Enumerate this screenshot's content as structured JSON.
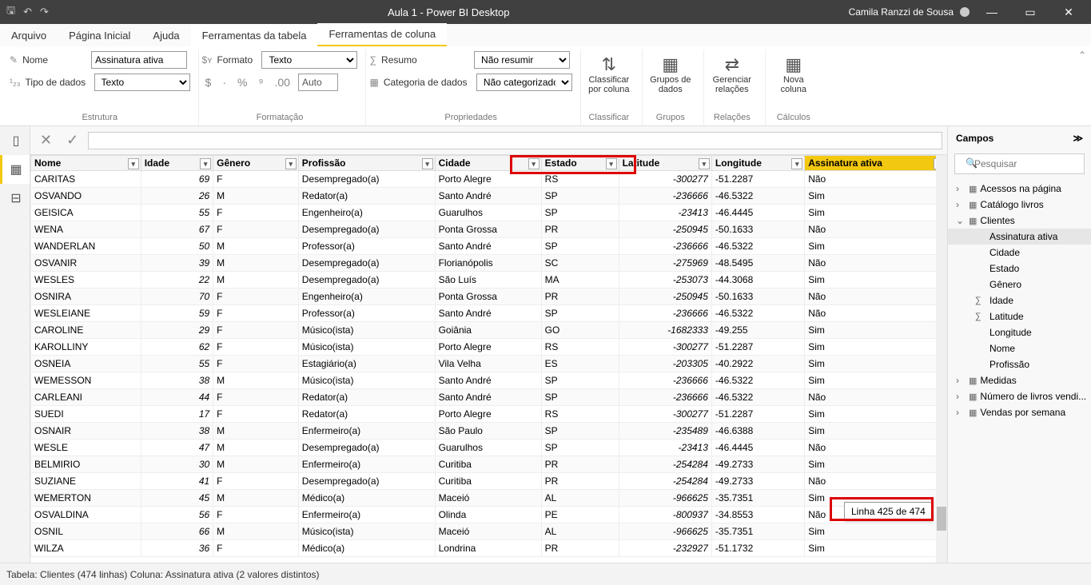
{
  "titlebar": {
    "title": "Aula 1 - Power BI Desktop",
    "user": "Camila Ranzzi de Sousa"
  },
  "menu": {
    "arquivo": "Arquivo",
    "pagina": "Página Inicial",
    "ajuda": "Ajuda",
    "ferramentas_tabela": "Ferramentas da tabela",
    "ferramentas_coluna": "Ferramentas de coluna"
  },
  "ribbon": {
    "nome_lbl": "Nome",
    "nome_val": "Assinatura ativa",
    "tipo_lbl": "Tipo de dados",
    "tipo_val": "Texto",
    "estrutura": "Estrutura",
    "formato_lbl": "Formato",
    "formato_val": "Texto",
    "auto": "Auto",
    "formatacao": "Formatação",
    "resumo_lbl": "Resumo",
    "resumo_val": "Não resumir",
    "categ_lbl": "Categoria de dados",
    "categ_val": "Não categorizado",
    "propriedades": "Propriedades",
    "classificar": "Classificar por coluna",
    "classificar_grp": "Classificar",
    "grupos": "Grupos de dados",
    "grupos_grp": "Grupos",
    "relacoes": "Gerenciar relações",
    "relacoes_grp": "Relações",
    "nova": "Nova coluna",
    "calculos_grp": "Cálculos"
  },
  "columns": [
    "Nome",
    "Idade",
    "Gênero",
    "Profissão",
    "Cidade",
    "Estado",
    "Latitude",
    "Longitude",
    "Assinatura ativa"
  ],
  "rows": [
    [
      "CARITAS",
      "69",
      "F",
      "Desempregado(a)",
      "Porto Alegre",
      "RS",
      "-300277",
      "-51.2287",
      "Não"
    ],
    [
      "OSVANDO",
      "26",
      "M",
      "Redator(a)",
      "Santo André",
      "SP",
      "-236666",
      "-46.5322",
      "Sim"
    ],
    [
      "GEISICA",
      "55",
      "F",
      "Engenheiro(a)",
      "Guarulhos",
      "SP",
      "-23413",
      "-46.4445",
      "Sim"
    ],
    [
      "WENA",
      "67",
      "F",
      "Desempregado(a)",
      "Ponta Grossa",
      "PR",
      "-250945",
      "-50.1633",
      "Não"
    ],
    [
      "WANDERLAN",
      "50",
      "M",
      "Professor(a)",
      "Santo André",
      "SP",
      "-236666",
      "-46.5322",
      "Sim"
    ],
    [
      "OSVANIR",
      "39",
      "M",
      "Desempregado(a)",
      "Florianópolis",
      "SC",
      "-275969",
      "-48.5495",
      "Não"
    ],
    [
      "WESLES",
      "22",
      "M",
      "Desempregado(a)",
      "São Luís",
      "MA",
      "-253073",
      "-44.3068",
      "Sim"
    ],
    [
      "OSNIRA",
      "70",
      "F",
      "Engenheiro(a)",
      "Ponta Grossa",
      "PR",
      "-250945",
      "-50.1633",
      "Não"
    ],
    [
      "WESLEIANE",
      "59",
      "F",
      "Professor(a)",
      "Santo André",
      "SP",
      "-236666",
      "-46.5322",
      "Não"
    ],
    [
      "CAROLINE",
      "29",
      "F",
      "Músico(ista)",
      "Goiânia",
      "GO",
      "-1682333",
      "-49.255",
      "Sim"
    ],
    [
      "KAROLLINY",
      "62",
      "F",
      "Músico(ista)",
      "Porto Alegre",
      "RS",
      "-300277",
      "-51.2287",
      "Sim"
    ],
    [
      "OSNEIA",
      "55",
      "F",
      "Estagiário(a)",
      "Vila Velha",
      "ES",
      "-203305",
      "-40.2922",
      "Sim"
    ],
    [
      "WEMESSON",
      "38",
      "M",
      "Músico(ista)",
      "Santo André",
      "SP",
      "-236666",
      "-46.5322",
      "Sim"
    ],
    [
      "CARLEANI",
      "44",
      "F",
      "Redator(a)",
      "Santo André",
      "SP",
      "-236666",
      "-46.5322",
      "Não"
    ],
    [
      "SUEDI",
      "17",
      "F",
      "Redator(a)",
      "Porto Alegre",
      "RS",
      "-300277",
      "-51.2287",
      "Sim"
    ],
    [
      "OSNAIR",
      "38",
      "M",
      "Enfermeiro(a)",
      "São Paulo",
      "SP",
      "-235489",
      "-46.6388",
      "Sim"
    ],
    [
      "WESLE",
      "47",
      "M",
      "Desempregado(a)",
      "Guarulhos",
      "SP",
      "-23413",
      "-46.4445",
      "Não"
    ],
    [
      "BELMIRIO",
      "30",
      "M",
      "Enfermeiro(a)",
      "Curitiba",
      "PR",
      "-254284",
      "-49.2733",
      "Sim"
    ],
    [
      "SUZIANE",
      "41",
      "F",
      "Desempregado(a)",
      "Curitiba",
      "PR",
      "-254284",
      "-49.2733",
      "Não"
    ],
    [
      "WEMERTON",
      "45",
      "M",
      "Médico(a)",
      "Maceió",
      "AL",
      "-966625",
      "-35.7351",
      "Sim"
    ],
    [
      "OSVALDINA",
      "56",
      "F",
      "Enfermeiro(a)",
      "Olinda",
      "PE",
      "-800937",
      "-34.8553",
      "Não"
    ],
    [
      "OSNIL",
      "66",
      "M",
      "Músico(ista)",
      "Maceió",
      "AL",
      "-966625",
      "-35.7351",
      "Sim"
    ],
    [
      "WILZA",
      "36",
      "F",
      "Médico(a)",
      "Londrina",
      "PR",
      "-232927",
      "-51.1732",
      "Sim"
    ]
  ],
  "fields_panel": {
    "title": "Campos",
    "search_ph": "Pesquisar",
    "tables": {
      "acessos": "Acessos na página",
      "catalogo": "Catálogo livros",
      "clientes": "Clientes",
      "medidas": "Medidas",
      "numero": "Número de livros vendi...",
      "vendas": "Vendas por semana"
    },
    "clientes_fields": [
      "Assinatura ativa",
      "Cidade",
      "Estado",
      "Gênero",
      "Idade",
      "Latitude",
      "Longitude",
      "Nome",
      "Profissão"
    ],
    "sigma_fields": [
      "Idade",
      "Latitude"
    ]
  },
  "tooltip": "Linha 425 de 474",
  "status": "Tabela: Clientes (474 linhas) Coluna: Assinatura ativa (2 valores distintos)"
}
